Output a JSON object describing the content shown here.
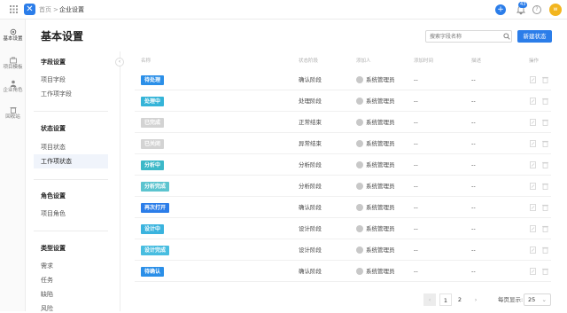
{
  "topbar": {
    "breadcrumb_home": "首页",
    "breadcrumb_sep": ">",
    "breadcrumb_current": "企业设置",
    "plus_label": "+",
    "notification_count": "43",
    "help_label": "?",
    "avatar_text": "w"
  },
  "leftnav": {
    "items": [
      {
        "label": "基本设置",
        "icon": "gear-icon"
      },
      {
        "label": "项目模板",
        "icon": "briefcase-icon"
      },
      {
        "label": "企业角色",
        "icon": "user-icon"
      },
      {
        "label": "回收站",
        "icon": "trash-icon"
      }
    ]
  },
  "page": {
    "title": "基本设置",
    "search_placeholder": "搜索字段名称",
    "new_button": "新建状态"
  },
  "subnav": {
    "sections": [
      {
        "heading": "字段设置",
        "items": [
          "项目字段",
          "工作项字段"
        ]
      },
      {
        "heading": "状态设置",
        "items": [
          "项目状态",
          "工作项状态"
        ]
      },
      {
        "heading": "角色设置",
        "items": [
          "项目角色"
        ]
      },
      {
        "heading": "类型设置",
        "items": [
          "需求",
          "任务",
          "缺陷",
          "风险"
        ]
      }
    ]
  },
  "table": {
    "columns": [
      "名称",
      "状态阶段",
      "添加人",
      "添加时间",
      "描述",
      "操作"
    ],
    "rows": [
      {
        "name": "待处理",
        "color": "#2b8fe8",
        "stage": "确认阶段",
        "owner": "系统管理员",
        "time": "--",
        "desc": "--"
      },
      {
        "name": "处理中",
        "color": "#35b4d8",
        "stage": "处理阶段",
        "owner": "系统管理员",
        "time": "--",
        "desc": "--"
      },
      {
        "name": "已完成",
        "color": "#d3d3d3",
        "stage": "正常结束",
        "owner": "系统管理员",
        "time": "--",
        "desc": "--"
      },
      {
        "name": "已关闭",
        "color": "#d3d3d3",
        "stage": "异常结束",
        "owner": "系统管理员",
        "time": "--",
        "desc": "--"
      },
      {
        "name": "分析中",
        "color": "#3cb8c8",
        "stage": "分析阶段",
        "owner": "系统管理员",
        "time": "--",
        "desc": "--"
      },
      {
        "name": "分析完成",
        "color": "#5cc4cf",
        "stage": "分析阶段",
        "owner": "系统管理员",
        "time": "--",
        "desc": "--"
      },
      {
        "name": "再次打开",
        "color": "#2b7de9",
        "stage": "确认阶段",
        "owner": "系统管理员",
        "time": "--",
        "desc": "--"
      },
      {
        "name": "设计中",
        "color": "#3ab3de",
        "stage": "设计阶段",
        "owner": "系统管理员",
        "time": "--",
        "desc": "--"
      },
      {
        "name": "设计完成",
        "color": "#48bde0",
        "stage": "设计阶段",
        "owner": "系统管理员",
        "time": "--",
        "desc": "--"
      },
      {
        "name": "待确认",
        "color": "#2b8fe8",
        "stage": "确认阶段",
        "owner": "系统管理员",
        "time": "--",
        "desc": "--"
      }
    ]
  },
  "pagination": {
    "prev": "‹",
    "pages": [
      "1",
      "2"
    ],
    "next": "›",
    "per_page_label": "每页显示:",
    "per_page_value": "25"
  }
}
